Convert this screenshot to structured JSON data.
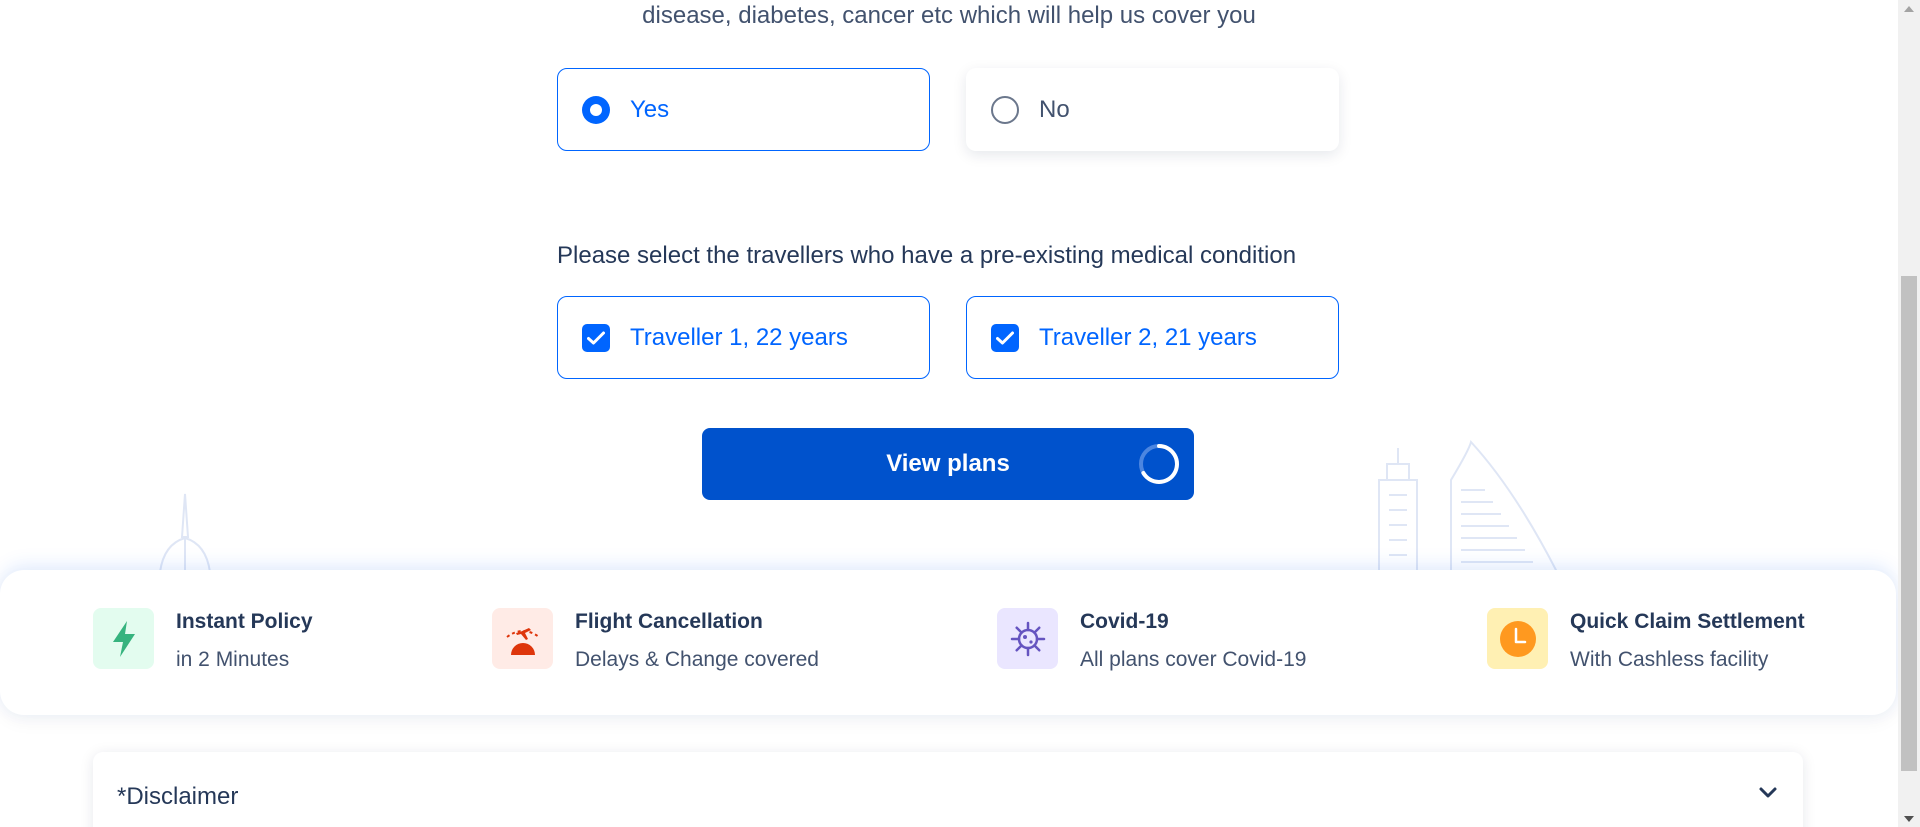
{
  "intro": {
    "text": "disease, diabetes, cancer etc which will help us cover you"
  },
  "medical_condition_question": {
    "options": [
      {
        "label": "Yes",
        "selected": true
      },
      {
        "label": "No",
        "selected": false
      }
    ]
  },
  "travellers": {
    "prompt": "Please select the travellers who have a pre-existing medical condition",
    "items": [
      {
        "label": "Traveller 1, 22 years",
        "checked": true
      },
      {
        "label": "Traveller 2, 21 years",
        "checked": true
      }
    ]
  },
  "cta": {
    "label": "View plans",
    "loading": true
  },
  "features": [
    {
      "title": "Instant Policy",
      "subtitle": "in 2 Minutes",
      "icon": "lightning-icon",
      "icon_bg": "#e3fcef",
      "icon_color": "#36b37e"
    },
    {
      "title": "Flight Cancellation",
      "subtitle": "Delays & Change covered",
      "icon": "flight-cancel-icon",
      "icon_bg": "#ffebe6",
      "icon_color": "#de350b"
    },
    {
      "title": "Covid-19",
      "subtitle": "All plans cover Covid-19",
      "icon": "virus-icon",
      "icon_bg": "#eae6ff",
      "icon_color": "#6554c0"
    },
    {
      "title": "Quick Claim Settlement",
      "subtitle": "With Cashless facility",
      "icon": "clock-icon",
      "icon_bg": "#fff0b3",
      "icon_color": "#ff991f"
    }
  ],
  "disclaimer": {
    "label": "*Disclaimer"
  },
  "colors": {
    "primary": "#0065ff",
    "button": "#0052cc",
    "text_dark": "#253858",
    "text_muted": "#42526e"
  }
}
